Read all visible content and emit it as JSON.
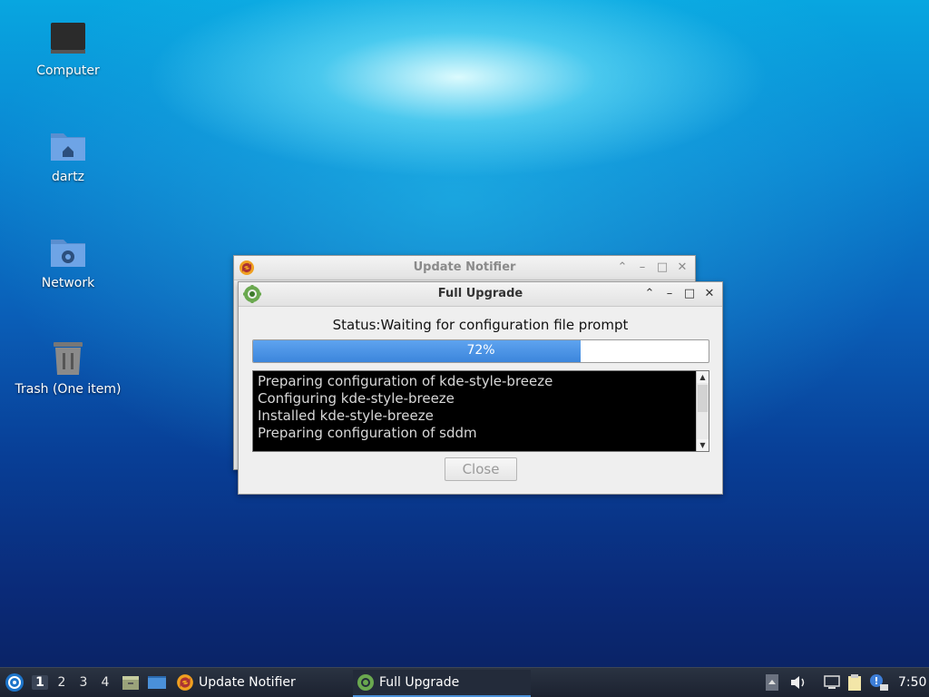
{
  "desktop": {
    "icons": [
      {
        "label": "Computer"
      },
      {
        "label": "dartz"
      },
      {
        "label": "Network"
      },
      {
        "label": "Trash (One item)"
      }
    ]
  },
  "update_notifier": {
    "title": "Update Notifier",
    "controls": {
      "minimize": "–",
      "maximize": "□",
      "close": "✕",
      "shade": "⌃"
    }
  },
  "full_upgrade": {
    "title": "Full Upgrade",
    "controls": {
      "shade": "⌃",
      "minimize": "–",
      "maximize": "□",
      "close": "✕"
    },
    "status": "Status:Waiting for configuration file prompt",
    "progress_percent": 72,
    "progress_label": "72%",
    "log_lines": [
      "Preparing configuration of kde-style-breeze",
      "Configuring kde-style-breeze",
      "Installed kde-style-breeze",
      "Preparing configuration of sddm"
    ],
    "close_button": "Close"
  },
  "taskbar": {
    "workspaces": [
      "1",
      "2",
      "3",
      "4"
    ],
    "active_workspace": "1",
    "tasks": [
      {
        "label": "Update Notifier",
        "icon": "update-notifier-icon"
      },
      {
        "label": "Full Upgrade",
        "icon": "gear-icon",
        "active": true
      }
    ],
    "clock": "7:50"
  },
  "colors": {
    "accent": "#3c86dc",
    "taskbar": "#1c2230"
  }
}
